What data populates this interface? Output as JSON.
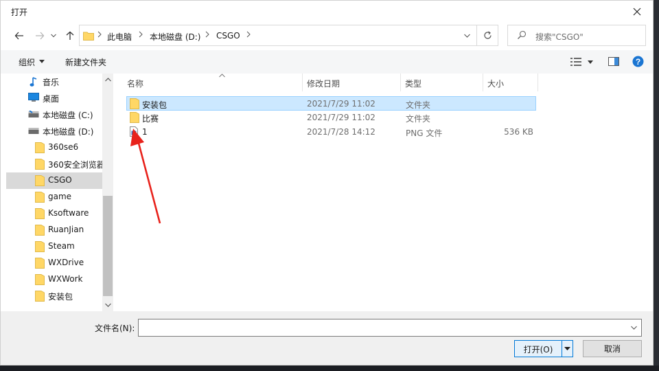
{
  "window": {
    "title": "打开"
  },
  "address": {
    "crumbs": [
      "此电脑",
      "本地磁盘 (D:)",
      "CSGO"
    ]
  },
  "search": {
    "placeholder": "搜索\"CSGO\""
  },
  "toolbar": {
    "organize": "组织",
    "new_folder": "新建文件夹"
  },
  "sidebar": {
    "items": [
      {
        "label": "音乐",
        "icon": "music-icon"
      },
      {
        "label": "桌面",
        "icon": "desktop-icon"
      },
      {
        "label": "本地磁盘 (C:)",
        "icon": "drive-icon"
      },
      {
        "label": "本地磁盘 (D:)",
        "icon": "drive-icon"
      },
      {
        "label": "360se6",
        "icon": "folder-icon"
      },
      {
        "label": "360安全浏览器",
        "icon": "folder-icon"
      },
      {
        "label": "CSGO",
        "icon": "folder-icon",
        "selected": true
      },
      {
        "label": "game",
        "icon": "folder-icon"
      },
      {
        "label": "Ksoftware",
        "icon": "folder-icon"
      },
      {
        "label": "RuanJian",
        "icon": "folder-icon"
      },
      {
        "label": "Steam",
        "icon": "folder-icon"
      },
      {
        "label": "WXDrive",
        "icon": "folder-icon"
      },
      {
        "label": "WXWork",
        "icon": "folder-icon"
      },
      {
        "label": "安装包",
        "icon": "folder-icon"
      }
    ]
  },
  "columns": {
    "name": "名称",
    "date": "修改日期",
    "type": "类型",
    "size": "大小"
  },
  "files": [
    {
      "name": "安装包",
      "date": "2021/7/29 11:02",
      "type": "文件夹",
      "size": "",
      "icon": "folder-icon",
      "selected": true
    },
    {
      "name": "比赛",
      "date": "2021/7/29 11:02",
      "type": "文件夹",
      "size": "",
      "icon": "folder-icon"
    },
    {
      "name": "1",
      "date": "2021/7/28 14:12",
      "type": "PNG 文件",
      "size": "536 KB",
      "icon": "png-file-icon"
    }
  ],
  "footer": {
    "filename_label": "文件名(N):",
    "filename_value": "",
    "open_label": "打开(O)",
    "cancel_label": "取消"
  },
  "colors": {
    "accent": "#0078d7",
    "selection": "#cce8ff",
    "folder": "#ffd766",
    "annotation": "#e8221b"
  }
}
